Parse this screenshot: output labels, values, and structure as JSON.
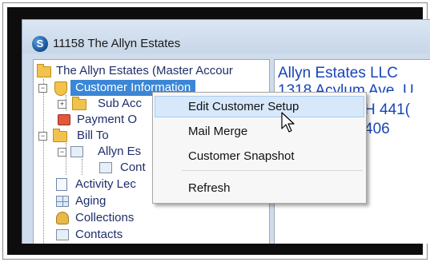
{
  "window": {
    "title": "11158 The Allyn Estates",
    "app_icon_letter": "S"
  },
  "tree": {
    "root": "The Allyn Estates (Master Accour",
    "customer_info": "Customer Information",
    "sub_acc": "Sub Acc",
    "payment": "Payment O",
    "bill_to": "Bill To",
    "allyn_es": "Allyn Es",
    "cont": "Cont",
    "activity": "Activity Lec",
    "aging": "Aging",
    "collections": "Collections",
    "contacts": "Contacts"
  },
  "details": {
    "company": "Allyn Estates LLC",
    "address": "1318 Acylum Ave. U",
    "city_frag": "H  441(",
    "phone_frag": "406"
  },
  "context_menu": {
    "items": [
      "Edit Customer Setup",
      "Mail Merge",
      "Customer Snapshot",
      "Refresh"
    ],
    "highlighted": "Edit Customer Setup"
  },
  "colors": {
    "selection": "#3b86d6",
    "menu_highlight": "#d6e8fa",
    "detail_text": "#1845b8"
  }
}
